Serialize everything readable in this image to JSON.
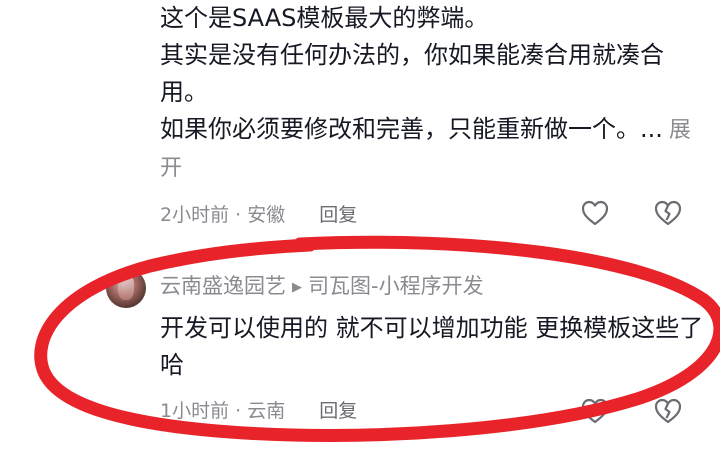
{
  "comment": {
    "lines": [
      "这个是SAAS模板最大的弊端。",
      "其实是没有任何办法的，你如果能凑合用就凑合用。",
      "如果你必须要修改和完善，只能重新做一个。..."
    ],
    "expand_label": "展开",
    "time": "2小时前",
    "location": "安徽",
    "reply_label": "回复"
  },
  "reply": {
    "author": "云南盛逸园艺",
    "reply_to": "司瓦图-小程序开发",
    "text": "开发可以使用的  就不可以增加功能  更换模板这些了哈",
    "time": "1小时前",
    "location": "云南",
    "reply_label": "回复"
  },
  "icons": {
    "like": "heart-outline-icon",
    "dislike": "broken-heart-icon",
    "reply_arrow": "triangle-right-icon"
  },
  "colors": {
    "annotation_ring": "#e8242a",
    "text": "#161823",
    "secondary": "#8a8b91"
  }
}
